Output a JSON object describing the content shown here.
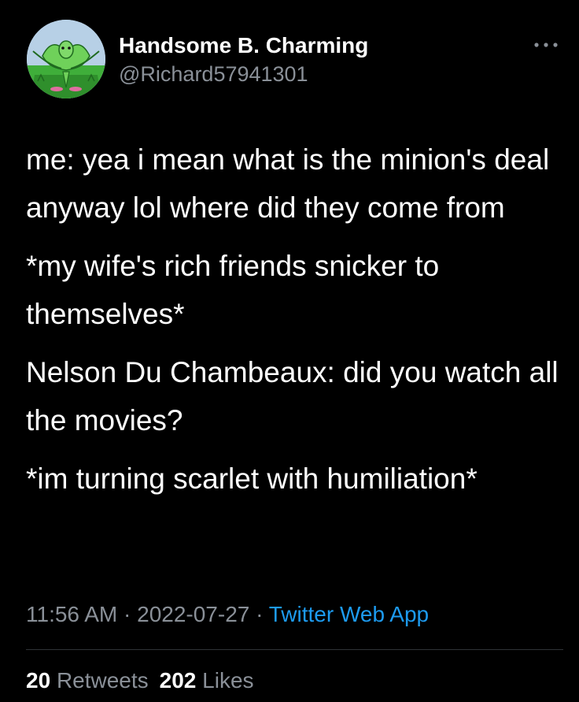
{
  "author": {
    "display_name": "Handsome B. Charming",
    "handle": "@Richard57941301",
    "avatar_icon": "green-cartoon-creature-avatar"
  },
  "menu": {
    "icon": "more-dots-icon"
  },
  "tweet": {
    "paragraphs": [
      "me: yea i mean what is the minion's deal anyway lol where did they come from",
      "*my wife's rich friends snicker to themselves*",
      "Nelson Du Chambeaux: did you watch all the movies?",
      "*im turning scarlet with humiliation*"
    ]
  },
  "meta": {
    "time": "11:56 AM",
    "separator": " · ",
    "date": "2022-07-27",
    "source": "Twitter Web App"
  },
  "stats": {
    "retweets_count": "20",
    "retweets_label": "Retweets",
    "likes_count": "202",
    "likes_label": "Likes"
  },
  "colors": {
    "background": "#000000",
    "primary_text": "#ffffff",
    "secondary_text": "#8a9098",
    "link": "#1d9bf0",
    "divider": "#2f3336"
  }
}
